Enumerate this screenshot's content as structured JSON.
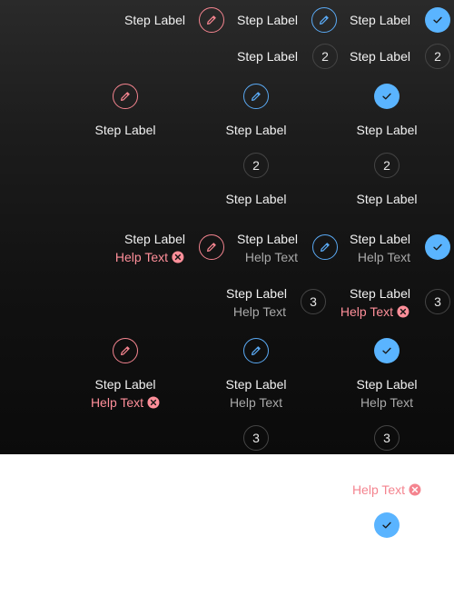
{
  "step_label": "Step Label",
  "help_text": "Help Text",
  "numbers": {
    "two": "2",
    "three": "3"
  },
  "colors": {
    "error": "#f4848f",
    "active": "#5aa9f3",
    "complete": "#5ab4ff",
    "label": "#f1f1f1",
    "help": "#a9a9a9",
    "dark_bg": "#111111",
    "light_bg": "#ffffff"
  },
  "icons": {
    "edit": "pencil-icon",
    "complete": "check-icon",
    "error": "error-x-icon"
  }
}
